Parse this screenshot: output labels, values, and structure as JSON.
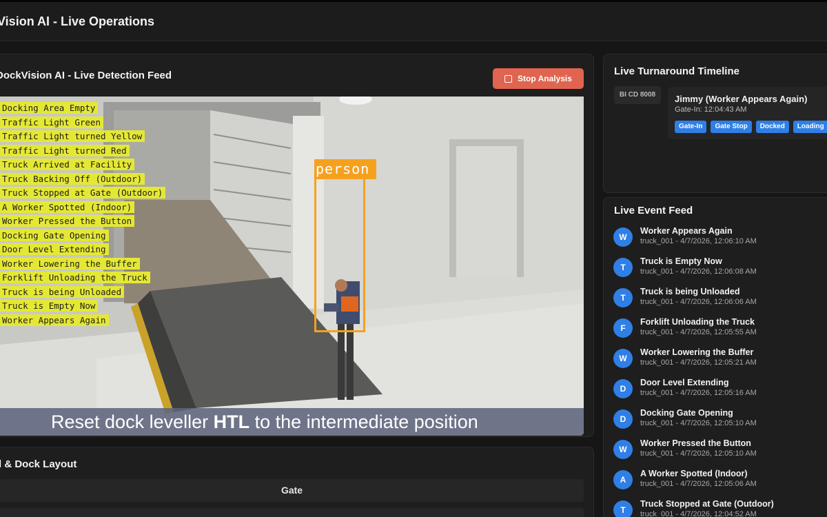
{
  "app": {
    "title": "Vision AI - Live Operations"
  },
  "feed": {
    "title": "DockVision AI - Live Detection Feed",
    "stop_label": "Stop Analysis",
    "detections": [
      "Docking Area Empty",
      "Traffic Light Green",
      "Traffic Light turned Yellow",
      "Traffic Light turned Red",
      "Truck Arrived at Facility",
      "Truck Backing Off (Outdoor)",
      "Truck Stopped at Gate (Outdoor)",
      "A Worker Spotted (Indoor)",
      "Worker Pressed the Button",
      "Docking Gate Opening",
      "Door Level Extending",
      "Worker Lowering the Buffer",
      "Forklift Unloading the Truck",
      "Truck is being Unloaded",
      "Truck is Empty Now",
      "Worker Appears Again"
    ],
    "person_label": "person",
    "subtitle_pre": "Reset dock leveller ",
    "subtitle_bold": "HTL",
    "subtitle_post": " to the intermediate position"
  },
  "layout": {
    "title": "l & Dock Layout",
    "gate_label": "Gate"
  },
  "timeline": {
    "title": "Live Turnaround Timeline",
    "plate": "BI CD 8008",
    "name": "Jimmy (Worker Appears Again)",
    "gate_in": "Gate-In: 12:04:43 AM",
    "chips": [
      "Gate-In",
      "Gate Stop",
      "Docked",
      "Loading"
    ]
  },
  "events": {
    "title": "Live Event Feed",
    "items": [
      {
        "initial": "W",
        "title": "Worker Appears Again",
        "meta": "truck_001 - 4/7/2026, 12:06:10 AM"
      },
      {
        "initial": "T",
        "title": "Truck is Empty Now",
        "meta": "truck_001 - 4/7/2026, 12:06:08 AM"
      },
      {
        "initial": "T",
        "title": "Truck is being Unloaded",
        "meta": "truck_001 - 4/7/2026, 12:06:06 AM"
      },
      {
        "initial": "F",
        "title": "Forklift Unloading the Truck",
        "meta": "truck_001 - 4/7/2026, 12:05:55 AM"
      },
      {
        "initial": "W",
        "title": "Worker Lowering the Buffer",
        "meta": "truck_001 - 4/7/2026, 12:05:21 AM"
      },
      {
        "initial": "D",
        "title": "Door Level Extending",
        "meta": "truck_001 - 4/7/2026, 12:05:16 AM"
      },
      {
        "initial": "D",
        "title": "Docking Gate Opening",
        "meta": "truck_001 - 4/7/2026, 12:05:10 AM"
      },
      {
        "initial": "W",
        "title": "Worker Pressed the Button",
        "meta": "truck_001 - 4/7/2026, 12:05:10 AM"
      },
      {
        "initial": "A",
        "title": "A Worker Spotted (Indoor)",
        "meta": "truck_001 - 4/7/2026, 12:05:06 AM"
      },
      {
        "initial": "T",
        "title": "Truck Stopped at Gate (Outdoor)",
        "meta": "truck_001 - 4/7/2026, 12:04:52 AM"
      }
    ]
  },
  "colors": {
    "accent": "#2f7fe6",
    "danger": "#e0644f",
    "detection": "#e4e834",
    "person_box": "#f5a11f"
  }
}
